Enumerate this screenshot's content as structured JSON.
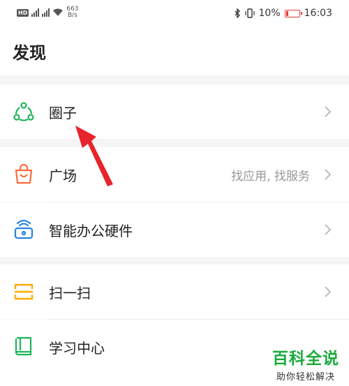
{
  "status_bar": {
    "network_speed_value": "663",
    "network_speed_unit": "B/s",
    "battery_percent": "10%",
    "time": "16:03"
  },
  "page_title": "发现",
  "items": [
    {
      "label": "圈子",
      "icon": "circle-group-icon",
      "hint": ""
    },
    {
      "label": "广场",
      "icon": "bag-icon",
      "hint": "找应用, 找服务"
    },
    {
      "label": "智能办公硬件",
      "icon": "office-hardware-icon",
      "hint": ""
    },
    {
      "label": "扫一扫",
      "icon": "scan-icon",
      "hint": ""
    },
    {
      "label": "学习中心",
      "icon": "book-icon",
      "hint": ""
    }
  ],
  "watermark": {
    "title": "百科全说",
    "subtitle": "助你轻松解决"
  },
  "colors": {
    "circle_icon": "#1fb35b",
    "bag_icon": "#ff6a3c",
    "office_icon": "#2a82e4",
    "scan_icon": "#ffab00",
    "book_icon": "#1fb35b",
    "arrow": "#e8242c",
    "watermark": "#1aab3c"
  }
}
